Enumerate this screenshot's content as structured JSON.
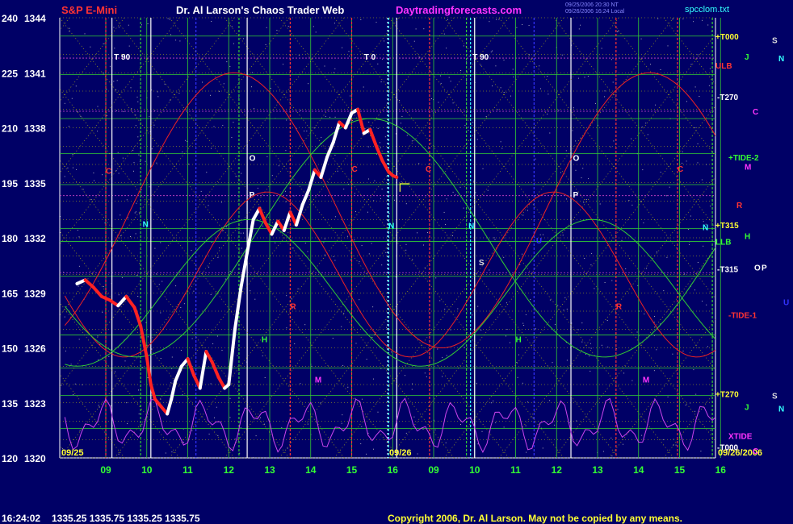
{
  "header": {
    "symbol": "S&P E-Mini",
    "title": "Dr. Al Larson's Chaos Trader Web",
    "site": "Daytradingforecasts.com",
    "filename": "spcclom.txt",
    "stamp_line1": "09/25/2006 20:30 NT",
    "stamp_line2": "09/26/2006 16:24 Local"
  },
  "footer": {
    "time": "16:24:02",
    "quote": "1335.25  1335.75  1335.25  1335.75",
    "copyright": "Copyright 2006, Dr. Al Larson. May not be copied by any means."
  },
  "colors": {
    "background": "#000066",
    "axis_text": "#ffffff",
    "hour_labels": "#33ff33",
    "title_red": "#ff3333",
    "title_white": "#ffffff",
    "site_magenta": "#ff33ff",
    "filename_cyan": "#33ffff",
    "copyright_yellow": "#ffff33",
    "grid_green": "#33cc33",
    "grid_yellow": "#cccc00",
    "grid_magenta": "#cc44cc",
    "curve_red": "#ee2222",
    "curve_green": "#33cc33",
    "curve_magenta": "#cc44ee",
    "price_up": "#ffffff",
    "price_down": "#ff2222"
  },
  "chart_data": {
    "type": "line",
    "title": "S&P E-Mini",
    "xlabel": "",
    "ylabel": "",
    "grid": true,
    "y_ticks": [
      {
        "left": "240",
        "right": "1344"
      },
      {
        "left": "225",
        "right": "1341"
      },
      {
        "left": "210",
        "right": "1338"
      },
      {
        "left": "195",
        "right": "1335"
      },
      {
        "left": "180",
        "right": "1332"
      },
      {
        "left": "165",
        "right": "1329"
      },
      {
        "left": "150",
        "right": "1326"
      },
      {
        "left": "135",
        "right": "1323"
      },
      {
        "left": "120",
        "right": "1320"
      }
    ],
    "ylim": [
      1320,
      1344
    ],
    "x_hours": [
      "09",
      "10",
      "11",
      "12",
      "13",
      "14",
      "15",
      "16",
      "09",
      "10",
      "11",
      "12",
      "13",
      "14",
      "15",
      "16"
    ],
    "date_labels": [
      "09/25",
      "09/26",
      "09/26/2006"
    ],
    "price_series": {
      "name": "",
      "hours": [
        8.3,
        8.5,
        8.7,
        8.9,
        9.1,
        9.3,
        9.5,
        9.7,
        9.85,
        10.0,
        10.1,
        10.2,
        10.35,
        10.5,
        10.6,
        10.7,
        10.85,
        11.0,
        11.15,
        11.3,
        11.45,
        11.6,
        11.75,
        11.9,
        12.0,
        12.15,
        12.3,
        12.45,
        12.6,
        12.75,
        12.9,
        13.05,
        13.2,
        13.35,
        13.5,
        13.65,
        13.8,
        13.95,
        14.1,
        14.25,
        14.4,
        14.55,
        14.7,
        14.85,
        15.0,
        15.15,
        15.3,
        15.45,
        15.6,
        15.75,
        15.9,
        16.0,
        16.1
      ],
      "values": [
        1329.5,
        1329.7,
        1329.3,
        1328.8,
        1328.6,
        1328.3,
        1328.8,
        1328.2,
        1327.2,
        1325.5,
        1324.0,
        1323.2,
        1322.8,
        1322.4,
        1323.2,
        1324.2,
        1325.0,
        1325.4,
        1324.5,
        1323.8,
        1325.8,
        1325.2,
        1324.4,
        1323.8,
        1324.0,
        1327.0,
        1329.3,
        1331.2,
        1333.0,
        1333.6,
        1332.8,
        1332.2,
        1332.9,
        1332.4,
        1333.4,
        1332.7,
        1333.8,
        1334.6,
        1335.7,
        1335.3,
        1336.4,
        1337.2,
        1338.3,
        1338.0,
        1338.8,
        1339.0,
        1337.7,
        1337.9,
        1337.0,
        1336.2,
        1335.6,
        1335.4,
        1335.3
      ]
    },
    "grid_labels_right": [
      {
        "text": "+T000",
        "color": "#ffff33",
        "value": 1343.0
      },
      {
        "text": "ULB",
        "color": "#ff3333",
        "value": 1341.4
      },
      {
        "text": "-T270",
        "color": "#ffffff",
        "value": 1339.7
      },
      {
        "text": "+TIDE-2",
        "color": "#33ff33",
        "value": 1336.4
      },
      {
        "text": "R",
        "color": "#ff3333",
        "value": 1333.8
      },
      {
        "text": "+T315",
        "color": "#ffff33",
        "value": 1332.7
      },
      {
        "text": "LLB",
        "color": "#33ff33",
        "value": 1331.8
      },
      {
        "text": "-T315",
        "color": "#ffffff",
        "value": 1330.3
      },
      {
        "text": "-TIDE-1",
        "color": "#ff3333",
        "value": 1327.8
      },
      {
        "text": "+T270",
        "color": "#ffff33",
        "value": 1323.5
      },
      {
        "text": "XTIDE",
        "color": "#ff33ff",
        "value": 1321.2
      },
      {
        "text": "-T000",
        "color": "#ffffff",
        "value": 1320.6
      }
    ],
    "planet_labels_right": [
      {
        "text": "S",
        "color": "#dddddd",
        "value": 1342.8,
        "col": 0
      },
      {
        "text": "N",
        "color": "#33ffff",
        "value": 1341.8,
        "col": 1
      },
      {
        "text": "J",
        "color": "#33ff33",
        "value": 1341.9,
        "col": -1
      },
      {
        "text": "C",
        "color": "#ff33ff",
        "value": 1338.9,
        "col": 0
      },
      {
        "text": "M",
        "color": "#ff33ff",
        "value": 1335.9,
        "col": -1
      },
      {
        "text": "H",
        "color": "#33ff33",
        "value": 1332.1,
        "col": -1
      },
      {
        "text": "N",
        "color": "#33ffff",
        "value": 1332.6,
        "col": -2
      },
      {
        "text": "O",
        "color": "#ffffff",
        "value": 1330.4,
        "col": 0
      },
      {
        "text": "P",
        "color": "#ffffff",
        "value": 1330.4,
        "col": 1
      },
      {
        "text": "U",
        "color": "#3333ff",
        "value": 1328.5,
        "col": 2
      },
      {
        "text": "S",
        "color": "#dddddd",
        "value": 1323.4,
        "col": 0
      },
      {
        "text": "N",
        "color": "#33ffff",
        "value": 1322.7,
        "col": 1
      },
      {
        "text": "J",
        "color": "#33ff33",
        "value": 1322.8,
        "col": -1
      },
      {
        "text": "C",
        "color": "#ff33ff",
        "value": 1320.4,
        "col": 0
      }
    ],
    "top_markers": [
      {
        "text": "T 90",
        "hour": 9.2
      },
      {
        "text": "T 0",
        "hour": 15.3
      },
      {
        "text": "T 90",
        "hour": 9.95,
        "day": 2
      }
    ],
    "chart_markers": [
      {
        "text": "C",
        "color": "#ff3333",
        "hour": 9.0,
        "value": 1335.5
      },
      {
        "text": "N",
        "color": "#33ffff",
        "hour": 9.9,
        "value": 1332.6
      },
      {
        "text": "O",
        "color": "#ffffff",
        "hour": 12.5,
        "value": 1336.2
      },
      {
        "text": "P",
        "color": "#ffffff",
        "hour": 12.5,
        "value": 1334.2
      },
      {
        "text": "C",
        "color": "#ff3333",
        "hour": 15.0,
        "value": 1335.6
      },
      {
        "text": "C",
        "color": "#ff3333",
        "hour": 16.8,
        "value": 1335.6
      },
      {
        "text": "N",
        "color": "#33ffff",
        "hour": 15.9,
        "value": 1332.5
      },
      {
        "text": "R",
        "color": "#ff3333",
        "hour": 13.5,
        "value": 1328.1
      },
      {
        "text": "H",
        "color": "#33ff33",
        "hour": 12.8,
        "value": 1326.3
      },
      {
        "text": "M",
        "color": "#ff33ff",
        "hour": 14.1,
        "value": 1324.1
      },
      {
        "text": "N",
        "color": "#33ffff",
        "hour": 9.85,
        "value": 1332.5,
        "day": 2
      },
      {
        "text": "S",
        "color": "#dddddd",
        "hour": 10.1,
        "value": 1330.5,
        "day": 2
      },
      {
        "text": "U",
        "color": "#3333ff",
        "hour": 11.5,
        "value": 1331.7,
        "day": 2
      },
      {
        "text": "O",
        "color": "#ffffff",
        "hour": 12.4,
        "value": 1336.2,
        "day": 2
      },
      {
        "text": "P",
        "color": "#ffffff",
        "hour": 12.4,
        "value": 1334.2,
        "day": 2
      },
      {
        "text": "H",
        "color": "#33ff33",
        "hour": 11.0,
        "value": 1326.3,
        "day": 2
      },
      {
        "text": "R",
        "color": "#ff3333",
        "hour": 13.45,
        "value": 1328.1,
        "day": 2
      },
      {
        "text": "M",
        "color": "#ff33ff",
        "hour": 14.1,
        "value": 1324.1,
        "day": 2
      },
      {
        "text": "C",
        "color": "#ff3333",
        "hour": 14.95,
        "value": 1335.6,
        "day": 2
      }
    ],
    "vertical_lines": [
      {
        "hour": 9.0,
        "color": "#ff3333"
      },
      {
        "hour": 9.15,
        "color": "#ffffff"
      },
      {
        "hour": 9.85,
        "color": "#33cc33"
      },
      {
        "hour": 10.1,
        "color": "#ffffff"
      },
      {
        "hour": 11.2,
        "color": "#3333ff"
      },
      {
        "hour": 12.25,
        "color": "#33cc33"
      },
      {
        "hour": 12.45,
        "color": "#ffffff"
      },
      {
        "hour": 13.5,
        "color": "#ff3333"
      },
      {
        "hour": 15.0,
        "color": "#ff3333"
      },
      {
        "hour": 15.9,
        "color": "#33ffff"
      },
      {
        "hour": 16.1,
        "color": "#ffffff"
      },
      {
        "hour": 16.9,
        "color": "#ff3333"
      },
      {
        "hour": 9.8,
        "color": "#33cc33",
        "day": 2
      },
      {
        "hour": 9.9,
        "color": "#33ffff",
        "day": 2
      },
      {
        "hour": 10.0,
        "color": "#ffffff",
        "day": 2
      },
      {
        "hour": 11.45,
        "color": "#3333ff",
        "day": 2
      },
      {
        "hour": 12.35,
        "color": "#ffffff",
        "day": 2
      },
      {
        "hour": 13.45,
        "color": "#ff3333",
        "day": 2
      },
      {
        "hour": 14.95,
        "color": "#ff3333",
        "day": 2
      },
      {
        "hour": 15.8,
        "color": "#33cc33",
        "day": 2
      }
    ]
  }
}
